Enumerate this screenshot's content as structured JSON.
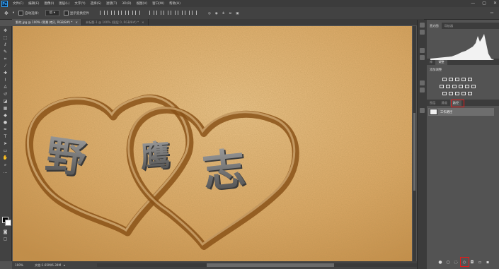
{
  "app": {
    "logo": "Ps"
  },
  "menu": [
    "文件(F)",
    "编辑(E)",
    "图像(I)",
    "图层(L)",
    "文字(Y)",
    "选择(S)",
    "滤镜(T)",
    "3D(D)",
    "视图(V)",
    "窗口(W)",
    "帮助(H)"
  ],
  "window_controls": [
    "—",
    "▢",
    "✕"
  ],
  "options": {
    "auto_select_label": "自动选择：",
    "auto_select_value": "组",
    "show_transform_label": "显示变换控件"
  },
  "tabs": [
    {
      "label": "野炊.jpg @ 100% (背景 拷贝, RGB/8#) *",
      "close": "×"
    },
    {
      "label": "未标题-1 @ 100% (图层 0, RGB/8#) *",
      "close": "×"
    }
  ],
  "status": {
    "zoom": "100%",
    "doc": "文档:1.65M/6.39M"
  },
  "canvas": {
    "characters": [
      "野",
      "鹰",
      "志"
    ],
    "colors": {
      "sand": "#d9a463",
      "sand_light": "#e8be84",
      "groove": "#7a4614",
      "letter": "#6e6e6e"
    }
  },
  "panels": {
    "top_tabs": [
      "直方图",
      "导航器"
    ],
    "mid_tabs": [
      "库",
      "调整"
    ],
    "add_adjustment": "添加调整",
    "layers_tabs": [
      "图层",
      "通道",
      "路径"
    ],
    "layer_name": "工作路径"
  },
  "colors": {
    "highlight": "#e01c1c",
    "panel": "#535353",
    "dark": "#3c3c3c"
  }
}
